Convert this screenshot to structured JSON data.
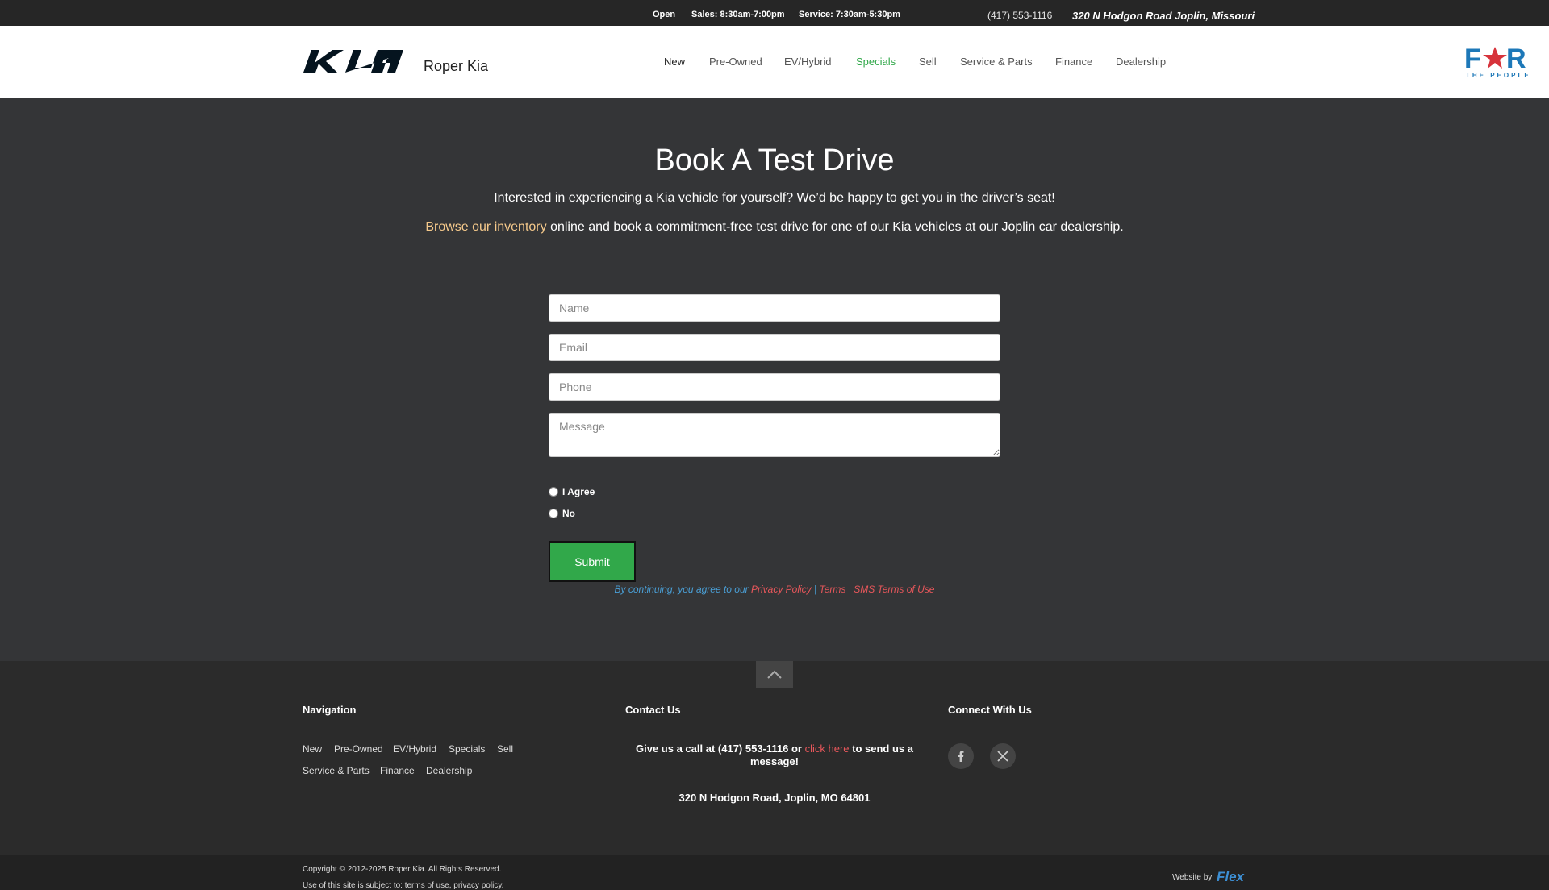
{
  "topbar": {
    "open": "Open",
    "sales": "Sales: 8:30am-7:00pm",
    "service": "Service: 7:30am-5:30pm",
    "phone": "(417) 553-1116",
    "address": "320 N Hodgon Road Joplin, Missouri"
  },
  "header": {
    "dealer_name": "Roper Kia",
    "nav": [
      "New",
      "Pre-Owned",
      "EV/Hybrid",
      "Specials",
      "Sell",
      "Service & Parts",
      "Finance",
      "Dealership"
    ],
    "logo_right_text": "FOR",
    "logo_right_sub": "THE PEOPLE"
  },
  "main": {
    "title": "Book A Test Drive",
    "intro1": "Interested in experiencing a Kia vehicle for yourself? We’d be happy to get you in the driver’s seat!",
    "intro2_link": "Browse our inventory",
    "intro2_rest": " online and book a commitment-free test drive for one of our Kia vehicles at our Joplin car dealership."
  },
  "form": {
    "name_placeholder": "Name",
    "email_placeholder": "Email",
    "phone_placeholder": "Phone",
    "message_placeholder": "Message",
    "agree_label": "I Agree",
    "no_label": "No",
    "submit_label": "Submit",
    "consent_prefix": "By continuing, you agree to our ",
    "privacy": "Privacy Policy",
    "sep1": " | ",
    "terms": "Terms",
    "sep2": " | ",
    "sms": "SMS Terms of Use"
  },
  "footer": {
    "nav_title": "Navigation",
    "contact_title": "Contact Us",
    "connect_title": "Connect With Us",
    "nav": [
      "New",
      "Pre-Owned",
      "EV/Hybrid",
      "Specials",
      "Sell",
      "Service & Parts",
      "Finance",
      "Dealership"
    ],
    "call_prefix": "Give us a call at (417) 553-1116 or ",
    "click_here": "click here",
    "call_suffix": " to send us a message!",
    "address": "320 N Hodgon Road, Joplin, MO 64801",
    "copyright": "Copyright © 2012-2025 Roper Kia. All Rights Reserved.",
    "terms_line": "Use of this site is subject to: terms of use, privacy policy.",
    "website_by": "Website by",
    "flex": "Flex"
  },
  "colors": {
    "accent_green": "#31a84a",
    "link_red": "#e8575b",
    "link_gold": "#f5c98b",
    "consent_blue": "#4a9fd6",
    "logo_blue": "#1d78b8"
  }
}
